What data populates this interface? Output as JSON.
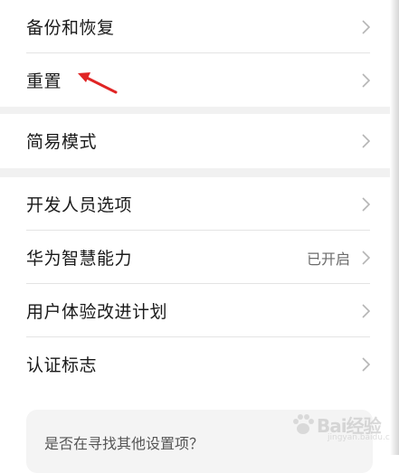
{
  "group1": {
    "items": [
      {
        "label": "备份和恢复"
      },
      {
        "label": "重置"
      }
    ]
  },
  "group2": {
    "items": [
      {
        "label": "简易模式"
      }
    ]
  },
  "group3": {
    "items": [
      {
        "label": "开发人员选项",
        "value": ""
      },
      {
        "label": "华为智慧能力",
        "value": "已开启"
      },
      {
        "label": "用户体验改进计划",
        "value": ""
      },
      {
        "label": "认证标志",
        "value": ""
      }
    ]
  },
  "hint": {
    "text": "是否在寻找其他设置项？"
  },
  "watermark": {
    "text": "Bai经验",
    "sub": "jingyan.baidu.com"
  },
  "colors": {
    "annotation_arrow": "#e02424",
    "section_gap": "#f1f1f1"
  },
  "icons": {
    "chevron": "chevron-right-icon",
    "annotation": "red-arrow-annotation"
  }
}
